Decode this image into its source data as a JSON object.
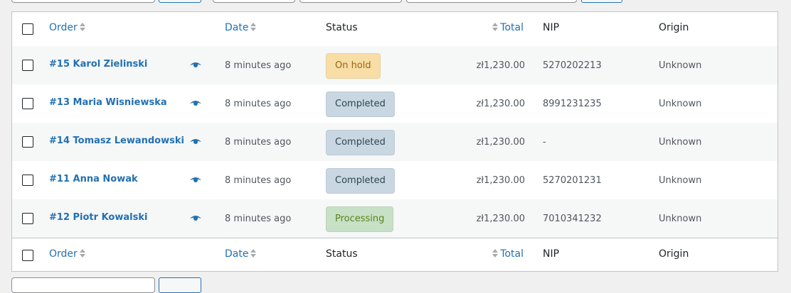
{
  "columns": {
    "order": "Order",
    "date": "Date",
    "status": "Status",
    "total": "Total",
    "nip": "NIP",
    "origin": "Origin"
  },
  "rows": [
    {
      "order": "#15 Karol Zielinski",
      "date": "8 minutes ago",
      "status": "On hold",
      "total": "zł1,230.00",
      "nip": "5270202213",
      "origin": "Unknown"
    },
    {
      "order": "#13 Maria Wisniewska",
      "date": "8 minutes ago",
      "status": "Completed",
      "total": "zł1,230.00",
      "nip": "8991231235",
      "origin": "Unknown"
    },
    {
      "order": "#14 Tomasz Lewandowski",
      "date": "8 minutes ago",
      "status": "Completed",
      "total": "zł1,230.00",
      "nip": "-",
      "origin": "Unknown"
    },
    {
      "order": "#11 Anna Nowak",
      "date": "8 minutes ago",
      "status": "Completed",
      "total": "zł1,230.00",
      "nip": "5270201231",
      "origin": "Unknown"
    },
    {
      "order": "#12 Piotr Kowalski",
      "date": "8 minutes ago",
      "status": "Processing",
      "total": "zł1,230.00",
      "nip": "7010341232",
      "origin": "Unknown"
    }
  ],
  "colors": {
    "link": "#2271b1",
    "on_hold_bg": "#f8dda7",
    "completed_bg": "#c8d7e1",
    "processing_bg": "#c6e1c6"
  },
  "icons": {
    "preview": "eye-icon",
    "sort": "sort-arrows-icon"
  }
}
